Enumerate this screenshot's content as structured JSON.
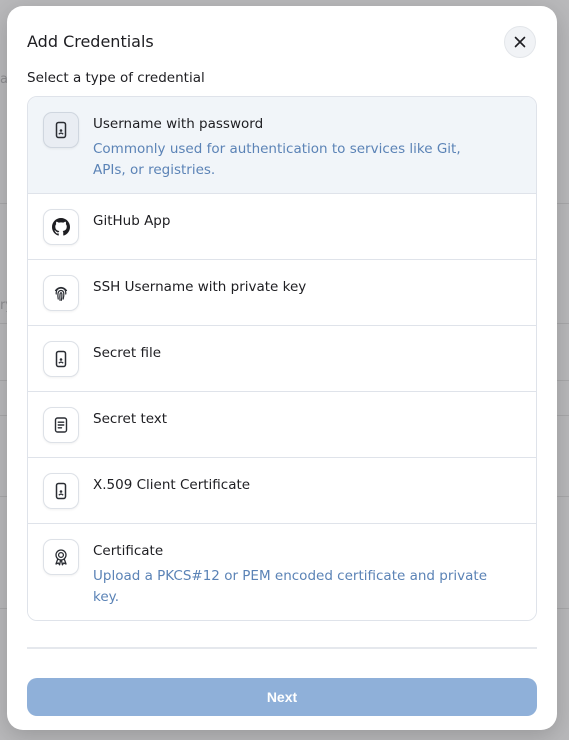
{
  "background": {
    "fragments": [
      "a",
      "ry"
    ]
  },
  "dialog": {
    "title": "Add Credentials",
    "close_icon": "close-icon",
    "subtitle": "Select a type of credential",
    "items": [
      {
        "title": "Username with password",
        "description": "Commonly used for authentication to services like Git, APIs, or registries.",
        "icon": "mobile-device-icon",
        "selected": true
      },
      {
        "title": "GitHub App",
        "description": "",
        "icon": "github-icon",
        "selected": false
      },
      {
        "title": "SSH Username with private key",
        "description": "",
        "icon": "fingerprint-icon",
        "selected": false
      },
      {
        "title": "Secret file",
        "description": "",
        "icon": "mobile-device-icon",
        "selected": false
      },
      {
        "title": "Secret text",
        "description": "",
        "icon": "document-icon",
        "selected": false
      },
      {
        "title": "X.509 Client Certificate",
        "description": "",
        "icon": "mobile-device-icon",
        "selected": false
      },
      {
        "title": "Certificate",
        "description": "Upload a PKCS#12 or PEM encoded certificate and private key.",
        "icon": "award-badge-icon",
        "selected": false
      }
    ],
    "next_label": "Next",
    "colors": {
      "accent": "#8fb0d9",
      "description_text": "#5b83b6",
      "selected_row": "#f1f5f9"
    }
  }
}
